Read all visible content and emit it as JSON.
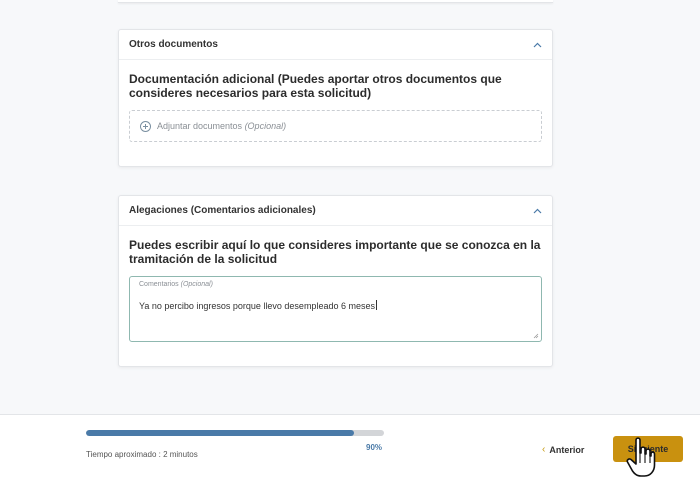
{
  "otros_documentos": {
    "title": "Otros documentos",
    "question": "Documentación adicional (Puedes aportar otros documentos que consideres necesarios para esta solicitud)",
    "upload_label": "Adjuntar documentos ",
    "upload_optional": "(Opcional)"
  },
  "alegaciones": {
    "title": "Alegaciones (Comentarios adicionales)",
    "question": "Puedes escribir aquí lo que consideres importante que se conozca en la tramitación de la solicitud",
    "field_label": "Comentarios ",
    "field_optional": "(Opcional)",
    "field_value": "Ya no percibo ingresos porque llevo desempleado 6 meses"
  },
  "footer": {
    "progress": 0.9,
    "progress_label": "90%",
    "time_text": "Tiempo aproximado : 2 minutos",
    "prev_label": "Anterior",
    "next_label": "Siguiente"
  },
  "colors": {
    "accent": "#c9910f",
    "progress": "#4a7aa8",
    "field_border": "#8fb8b0"
  }
}
